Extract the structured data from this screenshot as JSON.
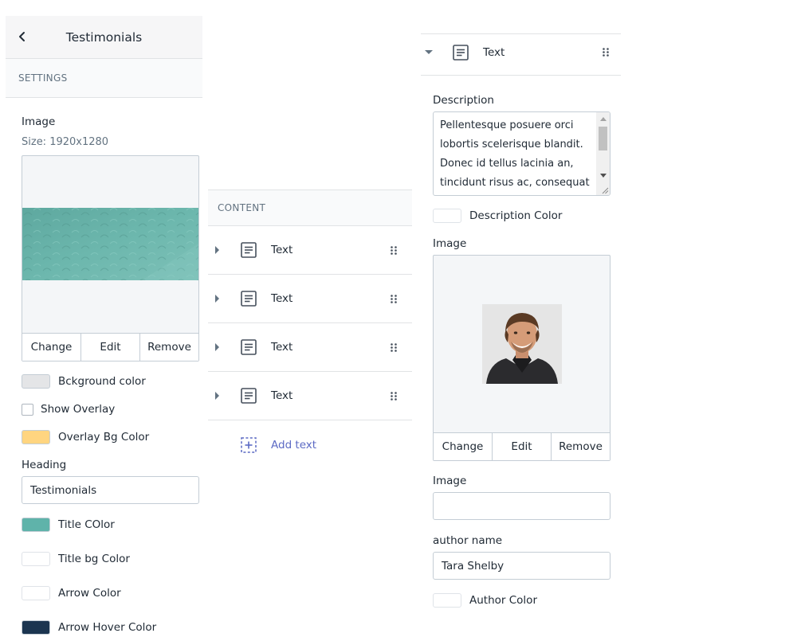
{
  "left_panel": {
    "title": "Testimonials",
    "section": "SETTINGS",
    "image": {
      "label": "Image",
      "size_text": "Size: 1920x1280",
      "actions": [
        "Change",
        "Edit",
        "Remove"
      ]
    },
    "background_color": {
      "label": "Bckground color",
      "value": "#e4e5e7"
    },
    "show_overlay": {
      "label": "Show Overlay",
      "checked": false
    },
    "overlay_bg_color": {
      "label": "Overlay Bg Color",
      "value": "#ffd580"
    },
    "heading": {
      "label": "Heading",
      "value": "Testimonials"
    },
    "title_color": {
      "label": "Title COlor",
      "value": "#5fb3aa"
    },
    "title_bg_color": {
      "label": "Title bg Color",
      "value": "#ffffff"
    },
    "arrow_color": {
      "label": "Arrow Color",
      "value": "#ffffff"
    },
    "arrow_hover_color": {
      "label": "Arrow Hover Color",
      "value": "#1b3550"
    }
  },
  "content_panel": {
    "section": "CONTENT",
    "blocks": [
      {
        "label": "Text",
        "icon": "text-block-icon"
      },
      {
        "label": "Text",
        "icon": "text-block-icon"
      },
      {
        "label": "Text",
        "icon": "text-block-icon"
      },
      {
        "label": "Text",
        "icon": "text-block-icon"
      }
    ],
    "add_label": "Add text",
    "add_color": "#5c6ac4"
  },
  "block_editor": {
    "title": "Text",
    "description": {
      "label": "Description",
      "value": "Pellentesque posuere orci lobortis scelerisque blandit. Donec id tellus lacinia an, tincidunt risus ac, consequat"
    },
    "description_color": {
      "label": "Description Color",
      "value": "#ffffff"
    },
    "image": {
      "label": "Image",
      "actions": [
        "Change",
        "Edit",
        "Remove"
      ]
    },
    "image_url": {
      "label": "Image",
      "value": ""
    },
    "author_name": {
      "label": "author name",
      "value": "Tara Shelby"
    },
    "author_color": {
      "label": "Author Color",
      "value": "#ffffff"
    }
  }
}
